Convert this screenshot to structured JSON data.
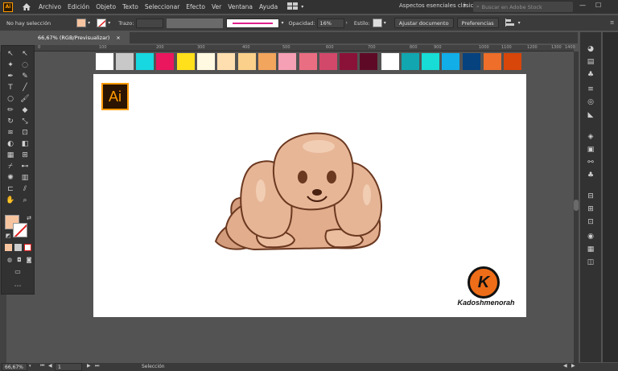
{
  "app": {
    "logo": "Ai",
    "home_icon": "home-icon"
  },
  "menu": [
    "Archivo",
    "Edición",
    "Objeto",
    "Texto",
    "Seleccionar",
    "Efecto",
    "Ver",
    "Ventana",
    "Ayuda"
  ],
  "workspace": {
    "label": "Aspectos esenciales clásicos",
    "search_placeholder": "Buscar en Adobe Stock"
  },
  "control": {
    "selection": "No hay selección",
    "stroke_label": "Trazo:",
    "opacity_label": "Opacidad:",
    "opacity_value": "16%",
    "style_label": "Estilo:",
    "adjust_doc": "Ajustar documento",
    "preferences": "Preferencias",
    "fill_color": "#f7c4a0",
    "stroke_line_color": "#e0208c"
  },
  "tab": {
    "title": "66,67% (RGB/Previsualizar)",
    "close": "×"
  },
  "ruler": [
    "0",
    "100",
    "200",
    "300",
    "400",
    "500",
    "600",
    "700",
    "800",
    "900",
    "1000",
    "1100",
    "1200",
    "1300",
    "1400"
  ],
  "swatches": [
    "#ffffff",
    "#c8c8c8",
    "#17d8e0",
    "#ea175e",
    "#ffe01a",
    "#fff9e1",
    "#ffdfb0",
    "#fbd08a",
    "#f2a55c",
    "#f5a0b4",
    "#ea6e82",
    "#d2486a",
    "#8a1238",
    "#5e0a26",
    "#ffffff",
    "#12a6b0",
    "#18dcd6",
    "#12aee8",
    "#06427e",
    "#ef6e2a",
    "#d8460a"
  ],
  "watermark": {
    "letter": "K",
    "name": "Kadoshmenorah"
  },
  "artboard_logo": "Ai",
  "status": {
    "zoom": "66,67%",
    "page": "1",
    "tool": "Selección"
  }
}
